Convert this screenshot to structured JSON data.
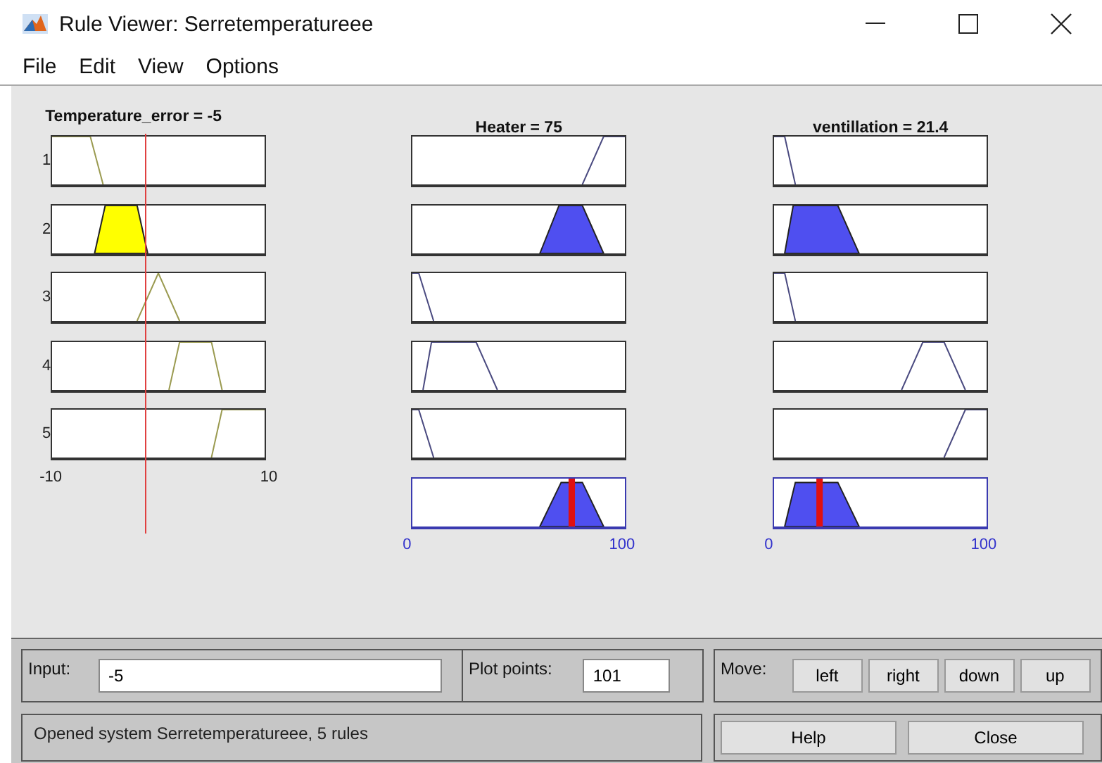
{
  "window": {
    "title": "Rule Viewer: Serretemperatureee"
  },
  "menu": [
    "File",
    "Edit",
    "View",
    "Options"
  ],
  "rule_numbers": [
    "1",
    "2",
    "3",
    "4",
    "5"
  ],
  "variables": [
    {
      "kind": "input",
      "title": "Temperature_error = -5",
      "cells": [
        {
          "filled": false
        },
        {
          "filled": true
        },
        {
          "filled": false
        },
        {
          "filled": false
        },
        {
          "filled": false
        }
      ],
      "ticks": [
        "-10",
        "10"
      ]
    },
    {
      "kind": "output",
      "title": "Heater = 75",
      "cells": [
        {
          "filled": false
        },
        {
          "filled": true
        },
        {
          "filled": false
        },
        {
          "filled": false
        },
        {
          "filled": false
        },
        {
          "filled": true
        }
      ],
      "ticks": [
        "0",
        "100"
      ]
    },
    {
      "kind": "output",
      "title": "ventillation = 21.4",
      "cells": [
        {
          "filled": false
        },
        {
          "filled": true
        },
        {
          "filled": false
        },
        {
          "filled": false
        },
        {
          "filled": false
        },
        {
          "filled": true
        }
      ],
      "ticks": [
        "0",
        "100"
      ]
    }
  ],
  "input_field": {
    "label": "Input:",
    "value": "-5"
  },
  "plot_points": {
    "label": "Plot points:",
    "value": "101"
  },
  "move": {
    "label": "Move:",
    "buttons": [
      "left",
      "right",
      "down",
      "up"
    ]
  },
  "status": "Opened system Serretemperatureee, 5 rules",
  "buttons": [
    "Help",
    "Close"
  ]
}
